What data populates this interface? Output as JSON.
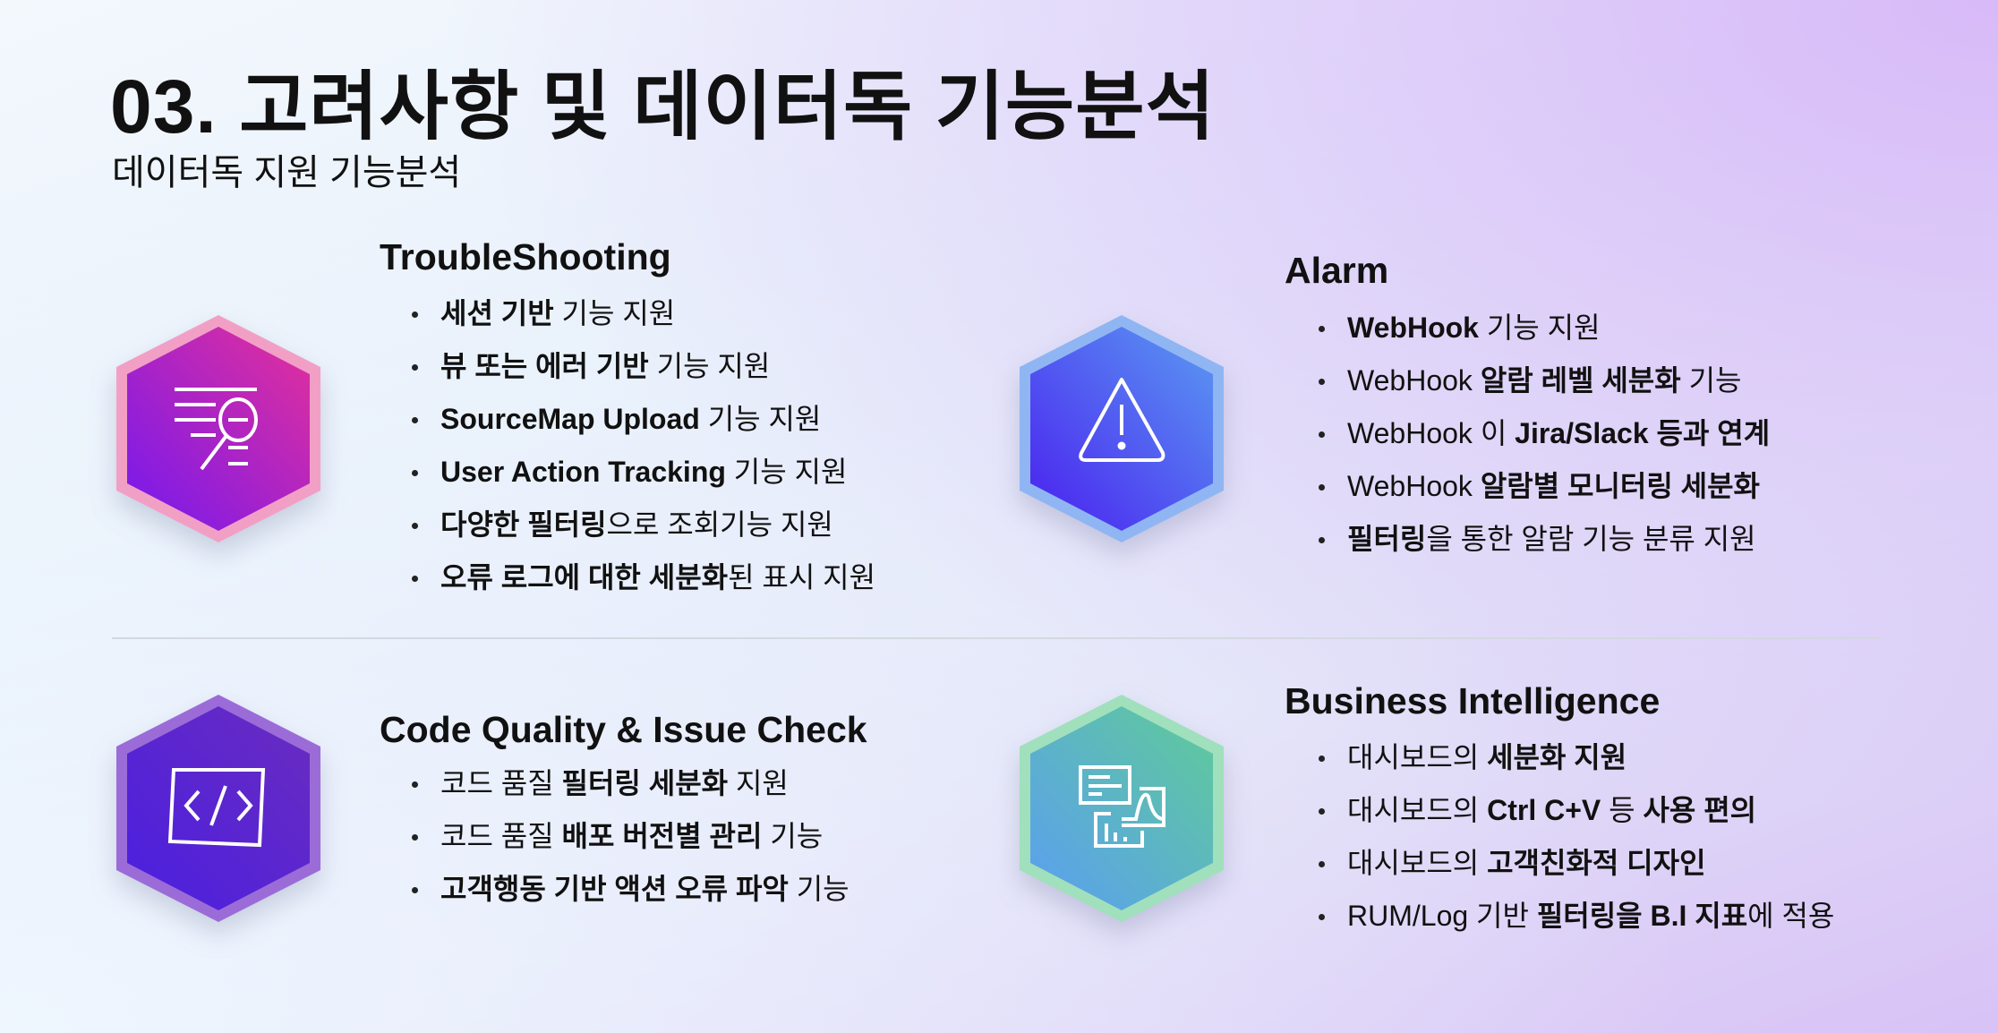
{
  "title": "03. 고려사항 및 데이터독 기능분석",
  "subtitle": "데이터독 지원 기능분석",
  "sections": {
    "troubleshooting": {
      "heading": "TroubleShooting",
      "icon": "document-search-icon",
      "colors": {
        "border": "#f29fc6",
        "from": "#7318ef",
        "to": "#e5309a"
      },
      "items": [
        {
          "segments": [
            {
              "text": "세션 기반",
              "bold": true
            },
            {
              "text": " 기능 지원",
              "bold": false
            }
          ]
        },
        {
          "segments": [
            {
              "text": "뷰 또는 에러 기반",
              "bold": true
            },
            {
              "text": " 기능 지원",
              "bold": false
            }
          ]
        },
        {
          "segments": [
            {
              "text": "SourceMap Upload",
              "bold": true
            },
            {
              "text": " 기능 지원",
              "bold": false
            }
          ]
        },
        {
          "segments": [
            {
              "text": "User Action Tracking",
              "bold": true
            },
            {
              "text": " 기능 지원",
              "bold": false
            }
          ]
        },
        {
          "segments": [
            {
              "text": "다양한 필터링",
              "bold": true
            },
            {
              "text": "으로 조회기능 지원",
              "bold": false
            }
          ]
        },
        {
          "segments": [
            {
              "text": "오류 로그에 대한 세분화",
              "bold": true
            },
            {
              "text": "된 표시 지원",
              "bold": false
            }
          ]
        }
      ]
    },
    "alarm": {
      "heading": "Alarm",
      "icon": "warning-icon",
      "colors": {
        "border": "#8fb6f3",
        "from": "#4a1ff0",
        "to": "#5a9af2"
      },
      "items": [
        {
          "segments": [
            {
              "text": "WebHook",
              "bold": true
            },
            {
              "text": " 기능 지원",
              "bold": false
            }
          ]
        },
        {
          "segments": [
            {
              "text": "WebHook ",
              "bold": false
            },
            {
              "text": "알람 레벨 세분화",
              "bold": true
            },
            {
              "text": " 기능",
              "bold": false
            }
          ]
        },
        {
          "segments": [
            {
              "text": "WebHook 이 ",
              "bold": false
            },
            {
              "text": "Jira/Slack 등과 연계",
              "bold": true
            }
          ]
        },
        {
          "segments": [
            {
              "text": "WebHook ",
              "bold": false
            },
            {
              "text": "알람별 모니터링 세분화",
              "bold": true
            }
          ]
        },
        {
          "segments": [
            {
              "text": "필터링",
              "bold": true
            },
            {
              "text": "을 통한 알람 기능 분류 지원",
              "bold": false
            }
          ]
        }
      ]
    },
    "code_quality": {
      "heading": "Code Quality & Issue Check",
      "icon": "code-icon",
      "colors": {
        "border": "#9b6cd8",
        "from": "#4a1fe0",
        "to": "#6a2cc0"
      },
      "items": [
        {
          "segments": [
            {
              "text": "코드 품질 ",
              "bold": false
            },
            {
              "text": "필터링 세분화",
              "bold": true
            },
            {
              "text": " 지원",
              "bold": false
            }
          ]
        },
        {
          "segments": [
            {
              "text": "코드 품질 ",
              "bold": false
            },
            {
              "text": "배포 버전별 관리",
              "bold": true
            },
            {
              "text": " 기능",
              "bold": false
            }
          ]
        },
        {
          "segments": [
            {
              "text": "고객행동 기반 액션 오류 파악",
              "bold": true
            },
            {
              "text": " 기능",
              "bold": false
            }
          ]
        }
      ]
    },
    "business_intelligence": {
      "heading": "Business Intelligence",
      "icon": "dashboard-chart-icon",
      "colors": {
        "border": "#a0e0bc",
        "from": "#5a9ef2",
        "to": "#5fcb98"
      },
      "items": [
        {
          "segments": [
            {
              "text": "대시보드의 ",
              "bold": false
            },
            {
              "text": "세분화 지원",
              "bold": true
            }
          ]
        },
        {
          "segments": [
            {
              "text": "대시보드의 ",
              "bold": false
            },
            {
              "text": "Ctrl C+V",
              "bold": true
            },
            {
              "text": " 등 ",
              "bold": false
            },
            {
              "text": "사용 편의",
              "bold": true
            }
          ]
        },
        {
          "segments": [
            {
              "text": "대시보드의 ",
              "bold": false
            },
            {
              "text": "고객친화적 디자인",
              "bold": true
            }
          ]
        },
        {
          "segments": [
            {
              "text": "RUM/Log 기반 ",
              "bold": false
            },
            {
              "text": "필터링을 B.I 지표",
              "bold": true
            },
            {
              "text": "에 적용",
              "bold": false
            }
          ]
        }
      ]
    }
  }
}
